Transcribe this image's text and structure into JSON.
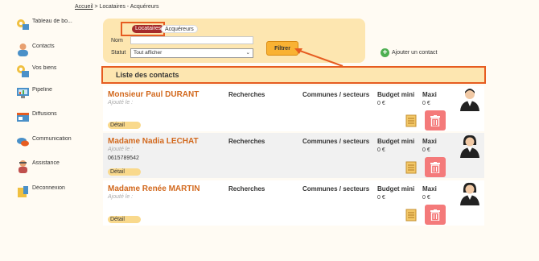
{
  "breadcrumb": {
    "home": "Accueil",
    "separator": " > ",
    "current": "Locataires - Acquéreurs"
  },
  "sidebar": {
    "items": [
      {
        "label": "Tableau de bo...",
        "icon": "dashboard-icon"
      },
      {
        "label": "Contacts",
        "icon": "contacts-icon"
      },
      {
        "label": "Vos biens",
        "icon": "properties-icon"
      },
      {
        "label": "Pipeline",
        "icon": "pipeline-icon"
      },
      {
        "label": "Diffusions",
        "icon": "broadcast-icon"
      },
      {
        "label": "Communication",
        "icon": "communication-icon"
      },
      {
        "label": "Assistance",
        "icon": "support-icon"
      },
      {
        "label": "Déconnexion",
        "icon": "logout-icon"
      }
    ]
  },
  "filter": {
    "tabs": {
      "active": "Locataires",
      "inactive": "Acquéreurs"
    },
    "name_label": "Nom",
    "name_value": "",
    "status_label": "Statut",
    "status_selected": "Tout afficher",
    "submit_label": "Filtrer"
  },
  "add_contact_label": "Ajouter un contact",
  "list": {
    "title": "Liste des contacts",
    "columns": {
      "searches": "Recherches",
      "communes": "Communes / secteurs",
      "budget_min": "Budget mini",
      "max": "Maxi"
    },
    "detail_label": "Détail",
    "contacts": [
      {
        "name": "Monsieur Paul DURANT",
        "added": "Ajouté le :",
        "phone": "",
        "budget_min": "0 €",
        "max": "0 €",
        "avatar": "male-avatar-icon"
      },
      {
        "name": "Madame Nadia LECHAT",
        "added": "Ajouté le :",
        "phone": "0615789542",
        "budget_min": "0 €",
        "max": "0 €",
        "avatar": "female-avatar-icon"
      },
      {
        "name": "Madame Renée MARTIN",
        "added": "Ajouté le :",
        "phone": "",
        "budget_min": "0 €",
        "max": "0 €",
        "avatar": "female-avatar-icon"
      }
    ]
  },
  "colors": {
    "accent": "#e65c20",
    "panel": "#fde6b0",
    "name": "#d2691e",
    "delete": "#f47a7a",
    "active_tab": "#a52a2a"
  }
}
